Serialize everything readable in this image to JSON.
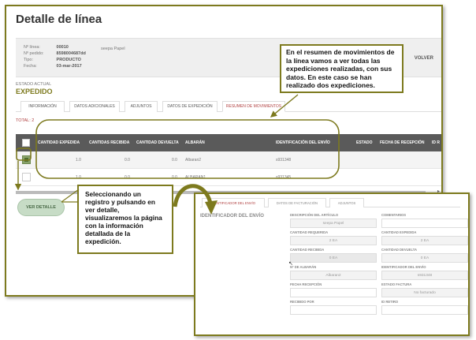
{
  "page": {
    "title": "Detalle de línea"
  },
  "info": {
    "rows": [
      {
        "label": "Nº línea:",
        "value": "00010"
      },
      {
        "label": "Nº pedido:",
        "value": "8598004687dd"
      },
      {
        "label": "Tipo:",
        "value": "PRODUCTO"
      },
      {
        "label": "Fecha:",
        "value": "03-mar-2017"
      }
    ],
    "extra": "seepa Papel",
    "volver": "VOLVER"
  },
  "estado": {
    "label": "ESTADO ACTUAL",
    "value": "EXPEDIDO"
  },
  "tabs": [
    "INFORMACIÓN",
    "DATOS ADICIONALES",
    "ADJUNTOS",
    "DATOS DE EXPEDICIÓN",
    "RESUMEN DE MOVIMIENTOS"
  ],
  "total": "TOTAL:  2",
  "table": {
    "headers": [
      "CANTIDAD EXPEDIDA",
      "CANTIDAS RECIBIDA",
      "CANTIDAD DEVUELTA",
      "ALBARÁN",
      "IDENTIFICACIÓN DEL ENVÍO",
      "ESTADO",
      "FECHA DE RECEPCIÓN",
      "ID R"
    ],
    "rows": [
      {
        "expedida": "1.0",
        "recibida": "0.0",
        "devuelta": "0.0",
        "albaran": "Albaran2",
        "envio": "s931348"
      },
      {
        "expedida": "1.0",
        "recibida": "0.0",
        "devuelta": "0.0",
        "albaran": "ALBARAN1",
        "envio": "s931345"
      }
    ]
  },
  "ver_detalle": "VER DETALLE",
  "callouts": {
    "top": "En el resumen de movimientos de la línea vamos a ver todas las expediciones realizadas, con sus datos.  En este caso se han realizado dos expediciones.",
    "left": "Seleccionando un registro y pulsando en ver detalle, visualizaremos la página con la información detallada de la expedición."
  },
  "detail": {
    "tabs": [
      "IDENTIFICADOR DEL ENVÍO",
      "DATOS DE FACTURACIÓN",
      "ADJUNTOS"
    ],
    "section": "IDENTIFICADOR DEL ENVÍO",
    "fields": {
      "descripcion_label": "DESCRIPCIÓN DEL ARTÍCULO",
      "descripcion": "seepa Papel",
      "comentarios_label": "COMENTARIOS",
      "comentarios": "",
      "requerida_label": "CANTIDAD REQUERIDA",
      "requerida": "2 EA",
      "expedida_label": "CANTIDAD EXPEDIDA",
      "expedida": "2 EA",
      "recibida_label": "CANTIDAD RECIBIDA",
      "recibida": "0 EA",
      "devuelta_label": "CANTIDAD DEVUELTA",
      "devuelta": "0 EA",
      "albaran_label": "Nº DE ALBARÁN",
      "albaran": "Albaran2",
      "envio_label": "IDENTIFICADOR DEL ENVÍO",
      "envio": "s931348",
      "fecha_label": "FECHA RECEPCIÓN",
      "fecha": "",
      "factura_label": "ESTADO FACTURA",
      "factura": "No facturado",
      "recibido_label": "RECIBIDO POR",
      "recibido": "",
      "idretiro_label": "ID RETIRO",
      "idretiro": ""
    }
  },
  "colors": {
    "accent_frame": "#7d7a1e",
    "active_tab": "#b04040",
    "table_header": "#5a5a5a",
    "button": "#c7dcc6"
  }
}
